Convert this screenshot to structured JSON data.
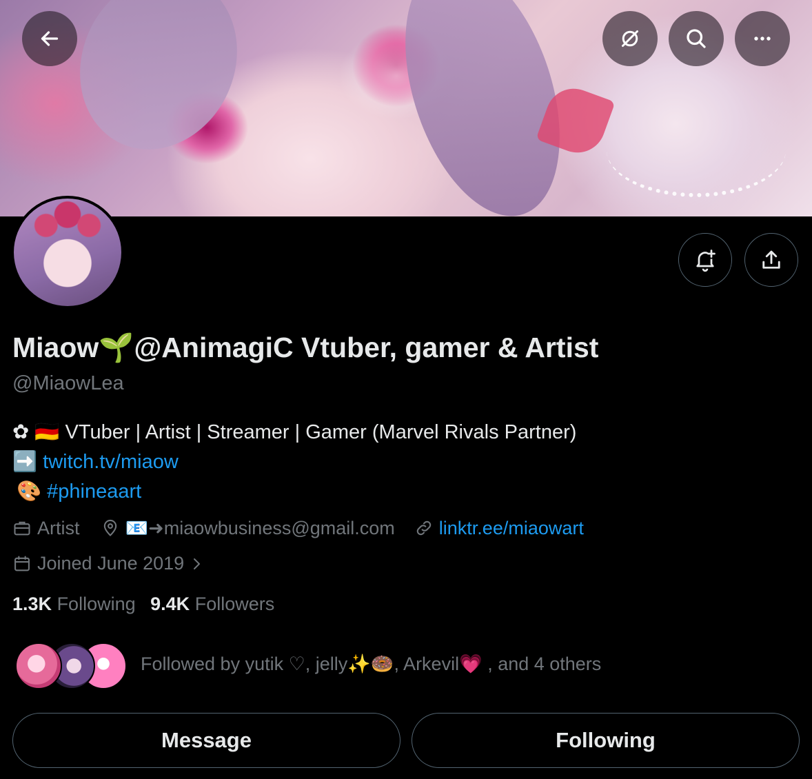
{
  "header": {
    "back_icon": "arrow-left-icon",
    "grok_icon": "grok-icon",
    "search_icon": "search-icon",
    "more_icon": "more-horizontal-icon"
  },
  "profile": {
    "display_name": "Miaow🌱@AnimagiC Vtuber, gamer & Artist",
    "handle": "@MiaowLea",
    "bio_line1": "✿ 🇩🇪 VTuber | Artist | Streamer | Gamer (Marvel Rivals Partner)",
    "bio_line2_prefix": "➡️",
    "bio_line2_link": "twitch.tv/miaow",
    "bio_line3_prefix": "🎨",
    "bio_line3_link": "#phineaart",
    "category": "Artist",
    "location": "📧➜miaowbusiness@gmail.com",
    "website": "linktr.ee/miaowart",
    "joined": "Joined June 2019",
    "following_count": "1.3K",
    "following_label": "Following",
    "followers_count": "9.4K",
    "followers_label": "Followers",
    "followed_by": "Followed by yutik ♡, jelly✨🍩, Arkevil💗 , and 4 others"
  },
  "actions": {
    "notify_icon": "bell-plus-icon",
    "share_icon": "share-icon",
    "message_label": "Message",
    "following_label": "Following"
  },
  "colors": {
    "background": "#000000",
    "text": "#e7e9ea",
    "muted": "#71767b",
    "link": "#1d9bf0",
    "border": "#536471"
  }
}
